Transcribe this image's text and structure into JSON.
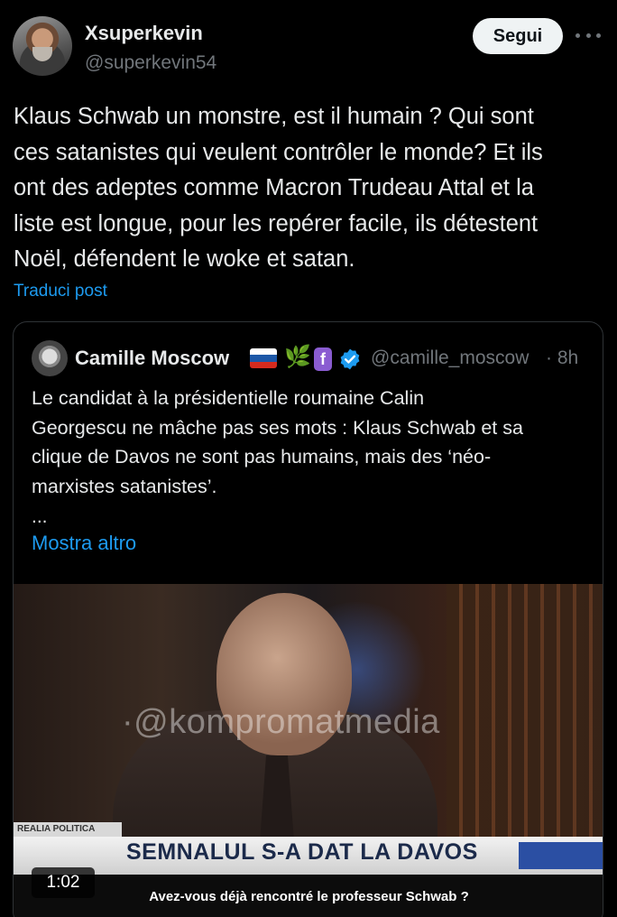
{
  "author": {
    "display_name": "Xsuperkevin",
    "handle": "@superkevin54"
  },
  "follow_label": "Segui",
  "more_icon": "more-horizontal-icon",
  "tweet": {
    "lines": [
      "Klaus Schwab un monstre, est il humain ? Qui sont",
      "ces satanistes qui veulent contrôler le monde? Et ils",
      "ont des adeptes comme Macron Trudeau Attal et la",
      "liste est longue, pour les repérer facile, ils détestent",
      "Noël, défendent le woke et satan."
    ],
    "translate_label": "Traduci post"
  },
  "quote": {
    "display_name": "Camille Moscow",
    "handle": "@camille_moscow",
    "time": "· 8h",
    "lines": [
      "Le candidat à la présidentielle roumaine Calin",
      "Georgescu ne mâche pas ses mots : Klaus Schwab et sa",
      "clique de Davos ne sont pas humains, mais des ‘néo-",
      "marxistes satanistes’."
    ],
    "ellipsis": "...",
    "show_more": "Mostra altro",
    "f_badge": "f",
    "verified_color": "#1d9bf0"
  },
  "video": {
    "watermark": "·@kompromatmedia",
    "ticker_label": "REALIA POLITICA",
    "ticker_text": "SEMNALUL S-A DAT LA DAVOS",
    "subtitle": "Avez-vous déjà rencontré le professeur Schwab ?",
    "duration": "1:02"
  },
  "colors": {
    "background": "#000000",
    "text": "#e7e9ea",
    "muted": "#71767b",
    "link": "#1d9bf0",
    "border": "#2f3336"
  }
}
